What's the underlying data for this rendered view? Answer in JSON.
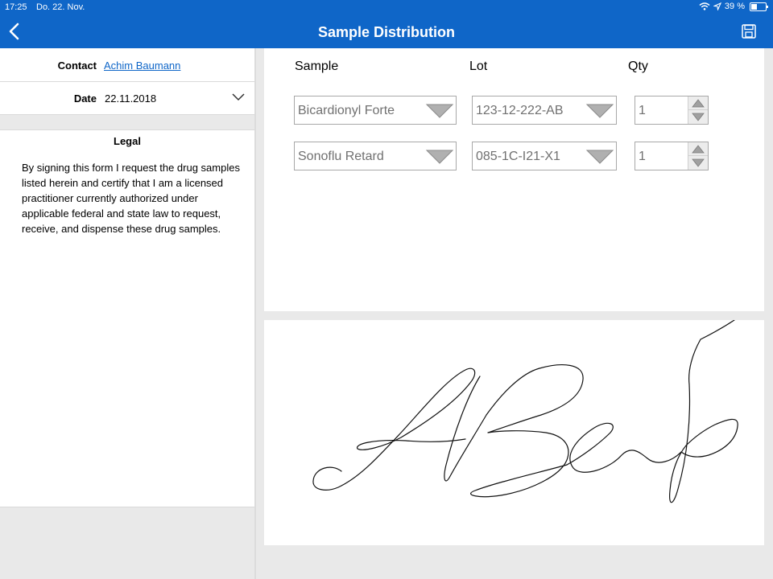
{
  "status_bar": {
    "time": "17:25",
    "date": "Do. 22. Nov.",
    "battery": "39 %",
    "battery_level": 0.39
  },
  "header": {
    "title": "Sample Distribution"
  },
  "contact": {
    "label": "Contact",
    "value": "Achim Baumann"
  },
  "date_field": {
    "label": "Date",
    "value": "22.11.2018"
  },
  "legal": {
    "title": "Legal",
    "text": "By signing this form I request the drug samples listed herein and certify that I am a licensed practitioner currently authorized under applicable federal and state law to request, receive, and dispense these drug samples."
  },
  "table": {
    "headers": {
      "sample": "Sample",
      "lot": "Lot",
      "qty": "Qty"
    },
    "rows": [
      {
        "sample": "Bicardionyl Forte",
        "lot": "123-12-222-AB",
        "qty": "1"
      },
      {
        "sample": "Sonoflu Retard",
        "lot": "085-1C-I21-X1",
        "qty": "1"
      }
    ]
  },
  "colors": {
    "header_bg": "#0f66c8",
    "link": "#0f66c8"
  }
}
